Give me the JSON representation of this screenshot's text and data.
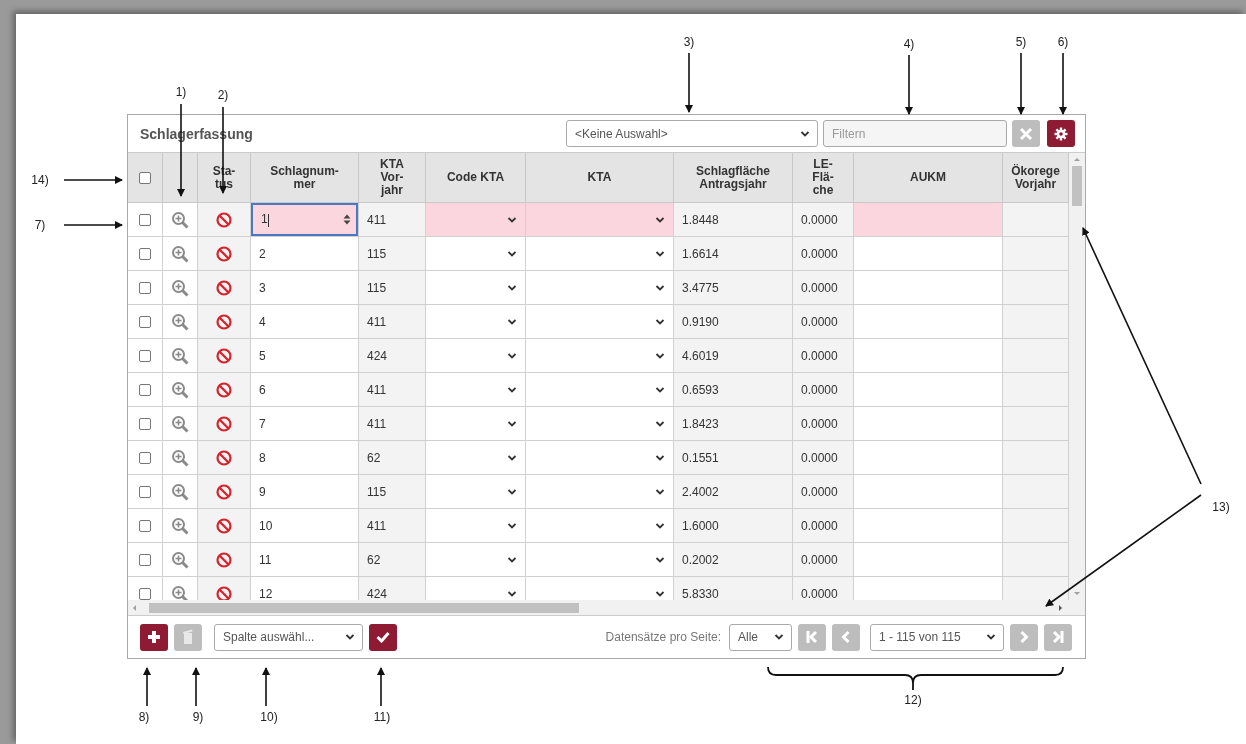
{
  "panel": {
    "title": "Schlagerfassung",
    "view_select": {
      "value": "<Keine Auswahl>"
    },
    "filter": {
      "placeholder": "Filtern"
    },
    "toolbar_buttons": [
      {
        "kind": "clear",
        "disabled": true
      },
      {
        "kind": "settings",
        "disabled": false
      }
    ]
  },
  "columns": [
    {
      "kind": "checkbox",
      "checked": false
    },
    {
      "kind": "zoom"
    },
    {
      "kind": "status",
      "lines": [
        "Sta-",
        "tus"
      ]
    },
    {
      "kind": "number",
      "lines": [
        "Schlagnum-",
        "mer"
      ]
    },
    {
      "kind": "readonly",
      "lines": [
        "KTA",
        "Vor-",
        "jahr"
      ]
    },
    {
      "kind": "select",
      "lines": [
        "Code KTA"
      ]
    },
    {
      "kind": "select",
      "lines": [
        "KTA"
      ]
    },
    {
      "kind": "readonly",
      "lines": [
        "Schlagfläche",
        "Antragsjahr"
      ]
    },
    {
      "kind": "readonly",
      "lines": [
        "LE-",
        "Flä-",
        "che"
      ]
    },
    {
      "kind": "text",
      "lines": [
        "AUKM"
      ]
    },
    {
      "kind": "blank",
      "lines": [
        "Ökorege",
        "Vorjahr"
      ]
    }
  ],
  "rows": [
    {
      "checked": false,
      "invalid": true,
      "editing": true,
      "values": [
        "1",
        "411",
        "1.8448",
        "0.0000"
      ]
    },
    {
      "checked": false,
      "invalid": false,
      "editing": false,
      "values": [
        "2",
        "115",
        "1.6614",
        "0.0000"
      ]
    },
    {
      "checked": false,
      "invalid": false,
      "editing": false,
      "values": [
        "3",
        "115",
        "3.4775",
        "0.0000"
      ]
    },
    {
      "checked": false,
      "invalid": false,
      "editing": false,
      "values": [
        "4",
        "411",
        "0.9190",
        "0.0000"
      ]
    },
    {
      "checked": false,
      "invalid": false,
      "editing": false,
      "values": [
        "5",
        "424",
        "4.6019",
        "0.0000"
      ]
    },
    {
      "checked": false,
      "invalid": false,
      "editing": false,
      "values": [
        "6",
        "411",
        "0.6593",
        "0.0000"
      ]
    },
    {
      "checked": false,
      "invalid": false,
      "editing": false,
      "values": [
        "7",
        "411",
        "1.8423",
        "0.0000"
      ]
    },
    {
      "checked": false,
      "invalid": false,
      "editing": false,
      "values": [
        "8",
        "62",
        "0.1551",
        "0.0000"
      ]
    },
    {
      "checked": false,
      "invalid": false,
      "editing": false,
      "values": [
        "9",
        "115",
        "2.4002",
        "0.0000"
      ]
    },
    {
      "checked": false,
      "invalid": false,
      "editing": false,
      "values": [
        "10",
        "411",
        "1.6000",
        "0.0000"
      ]
    },
    {
      "checked": false,
      "invalid": false,
      "editing": false,
      "values": [
        "11",
        "62",
        "0.2002",
        "0.0000"
      ]
    },
    {
      "checked": false,
      "invalid": false,
      "editing": false,
      "values": [
        "12",
        "424",
        "5.8330",
        "0.0000"
      ]
    }
  ],
  "footer": {
    "add_button": {
      "disabled": false
    },
    "delete_button": {
      "disabled": true
    },
    "column_select": {
      "value": "Spalte auswähl..."
    },
    "apply_button": {
      "disabled": false
    },
    "page_size_label": "Datensätze pro Seite:",
    "page_size": {
      "value": "Alle"
    },
    "page_select": {
      "value": "1 - 115 von 115"
    },
    "pager_buttons": [
      {
        "kind": "first",
        "disabled": true
      },
      {
        "kind": "prev",
        "disabled": true
      },
      {
        "kind": "next",
        "disabled": true
      },
      {
        "kind": "last",
        "disabled": true
      }
    ]
  },
  "callouts": [
    {
      "label": "1)"
    },
    {
      "label": "2)"
    },
    {
      "label": "3)"
    },
    {
      "label": "4)"
    },
    {
      "label": "5)"
    },
    {
      "label": "6)"
    },
    {
      "label": "14)"
    },
    {
      "label": "7)"
    },
    {
      "label": "8)"
    },
    {
      "label": "9)"
    },
    {
      "label": "10)"
    },
    {
      "label": "11)"
    },
    {
      "label": "12)"
    },
    {
      "label": "13)"
    }
  ]
}
